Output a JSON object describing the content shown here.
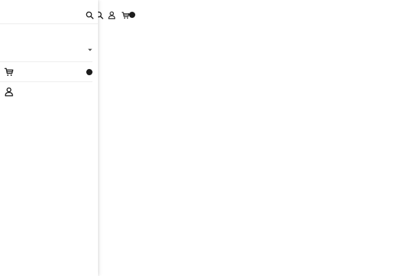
{
  "header": {
    "icons": {
      "search": "search-icon",
      "account": "account-icon",
      "cart": "cart-icon"
    },
    "cart_count": ""
  },
  "drawer": {
    "search_icon": "search-icon",
    "dropdown": {
      "label": "",
      "icon": "chevron-down-icon"
    },
    "cart": {
      "label": "",
      "icon": "cart-icon",
      "count": ""
    },
    "account": {
      "label": "",
      "icon": "account-icon"
    }
  },
  "colors": {
    "text": "#1c1c1c",
    "badge": "#1c1c1c",
    "divider": "#ececec",
    "background": "#ffffff"
  }
}
